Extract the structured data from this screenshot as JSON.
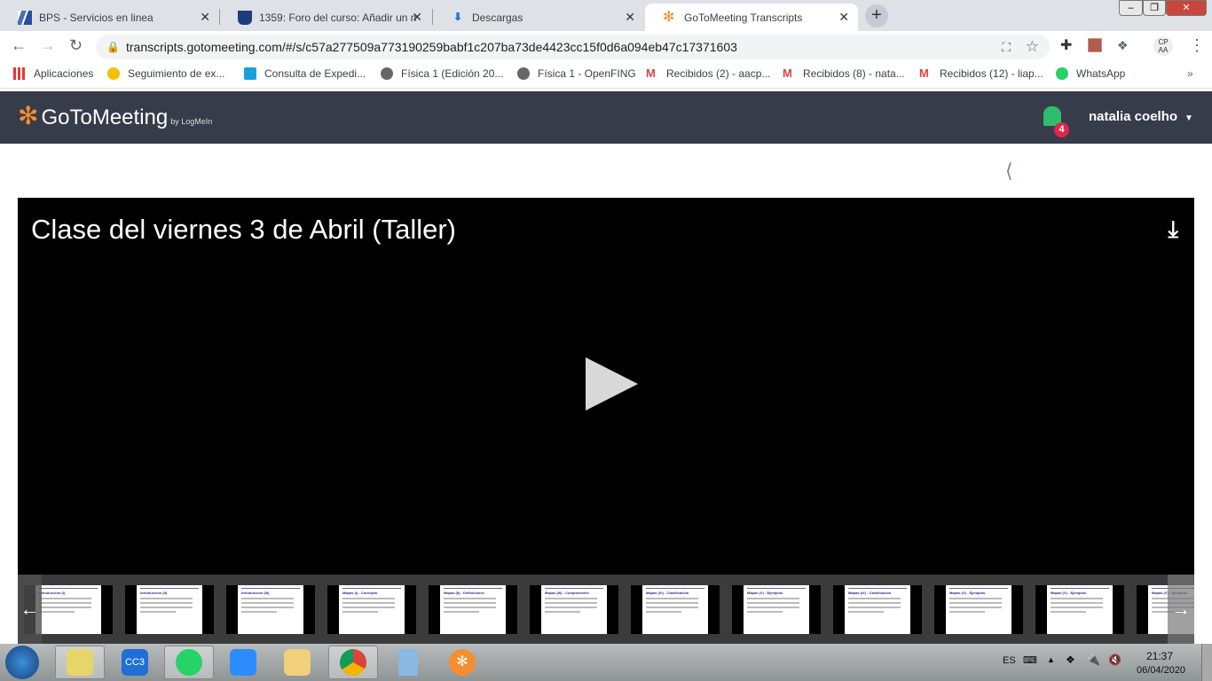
{
  "browser": {
    "tabs": [
      {
        "title": "BPS - Servicios en linea",
        "active": false
      },
      {
        "title": "1359: Foro del curso: Añadir un n",
        "active": false
      },
      {
        "title": "Descargas",
        "active": false
      },
      {
        "title": "GoToMeeting Transcripts",
        "active": true
      }
    ],
    "url": "transcripts.gotomeeting.com/#/s/c57a277509a773190259babf1c207ba73de4423cc15f0d6a094eb47c17371603",
    "profile": "CP AA",
    "bookmarks": [
      "Aplicaciones",
      "Seguimiento de ex...",
      "Consulta de Expedi...",
      "Física 1 (Edición 20...",
      "Física 1 - OpenFING",
      "Recibidos (2) - aacp...",
      "Recibidos (8) - nata...",
      "Recibidos (12) - liap...",
      "WhatsApp"
    ],
    "more": "»"
  },
  "app": {
    "logo": "GoToMeeting",
    "logo_by": "by LogMeIn",
    "notifications": "4",
    "user": "natalia coelho",
    "video_title": "Clase del viernes 3 de Abril (Taller)",
    "accent": "#f68d2e",
    "bell_color": "#2ebd6b",
    "thumbnails": [
      "Introducción (I)",
      "Introducción (II)",
      "Introducción (III)",
      "Mapas (I) - Concepto",
      "Mapas (II) - Definiciones",
      "Mapas (III) - Componentes",
      "Mapas (IV) - Clasificación",
      "Mapas (V) - Ejemplos",
      "Mapas (IV) - Clasificación",
      "Mapas (V) - Ejemplos",
      "Mapas (V) - Ejemplos",
      "Mapas (V) - Ejemplos"
    ]
  },
  "taskbar": {
    "lang": "ES",
    "time": "21:37",
    "date": "06/04/2020",
    "calc": "0"
  }
}
